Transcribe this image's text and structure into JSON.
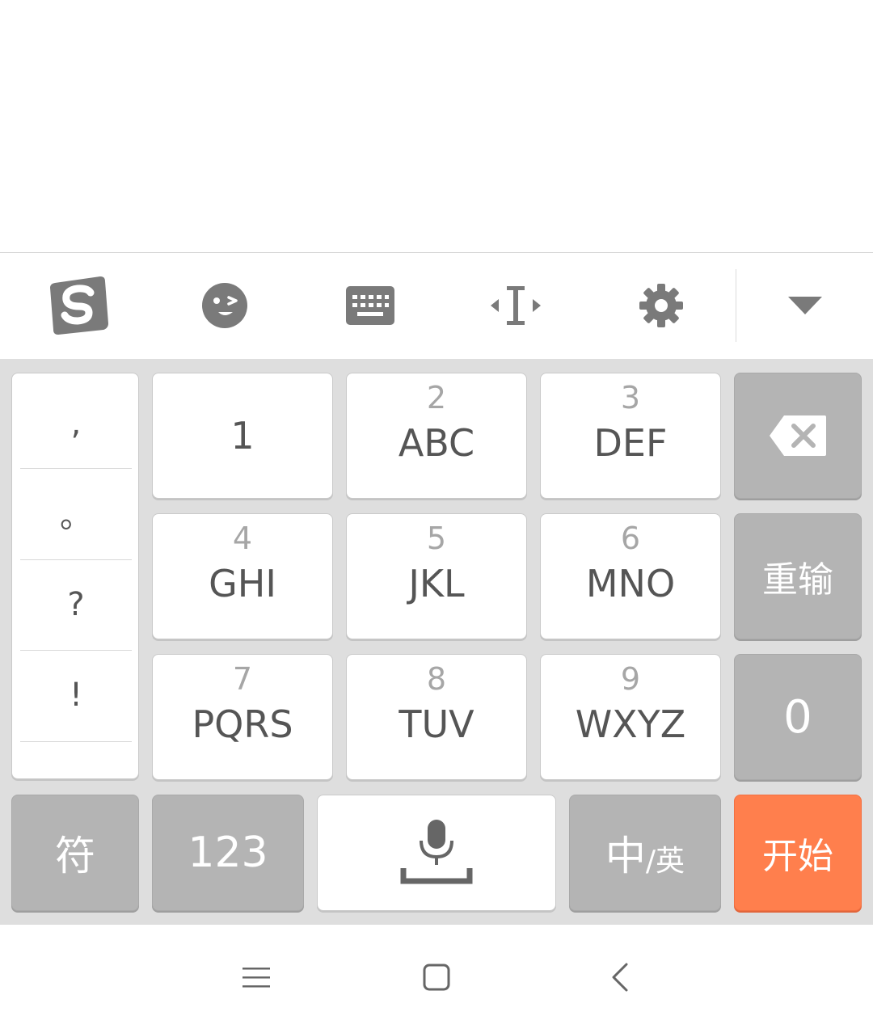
{
  "toolbar": {
    "icons": [
      "sogou-logo-icon",
      "emoji-icon",
      "keyboard-icon",
      "cursor-move-icon",
      "gear-icon",
      "collapse-down-icon"
    ]
  },
  "punctuation": [
    ",",
    "。",
    "?",
    "!"
  ],
  "keys": {
    "k1": {
      "letters": "1"
    },
    "k2": {
      "digit": "2",
      "letters": "ABC"
    },
    "k3": {
      "digit": "3",
      "letters": "DEF"
    },
    "k4": {
      "digit": "4",
      "letters": "GHI"
    },
    "k5": {
      "digit": "5",
      "letters": "JKL"
    },
    "k6": {
      "digit": "6",
      "letters": "MNO"
    },
    "k7": {
      "digit": "7",
      "letters": "PQRS"
    },
    "k8": {
      "digit": "8",
      "letters": "TUV"
    },
    "k9": {
      "digit": "9",
      "letters": "WXYZ"
    }
  },
  "side_keys": {
    "reinput": "重输",
    "zero": "0"
  },
  "bottom_keys": {
    "symbols": "符",
    "numbers": "123",
    "lang_main": "中",
    "lang_sub": "/英",
    "start": "开始"
  },
  "colors": {
    "key_white": "#ffffff",
    "key_gray": "#b4b4b4",
    "key_orange": "#ff7f4d",
    "keyboard_bg": "#dedede",
    "icon_gray": "#7a7a7a"
  },
  "navbar": {
    "icons": [
      "menu-icon",
      "home-icon",
      "back-icon"
    ]
  }
}
